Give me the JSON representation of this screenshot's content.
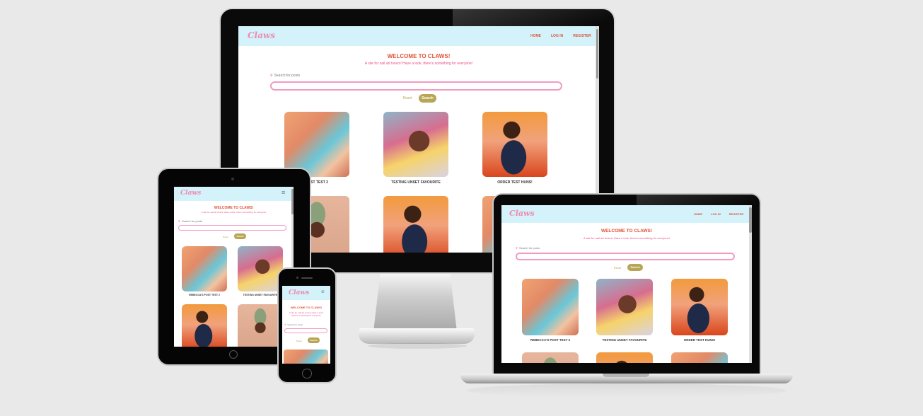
{
  "site": {
    "logo": "Claws",
    "nav": [
      "HOME",
      "LOG IN",
      "REGISTER"
    ],
    "title": "WELCOME TO CLAWS!",
    "tagline": "A site for nail art lovers! Have a look, there's something for everyone!",
    "search_label": "Search for posts",
    "reset_label": "Reset",
    "search_button": "Search",
    "hamburger": "≡",
    "posts": [
      {
        "title": "REBECCA'S POST TEST 2"
      },
      {
        "title": "TESTING UNSET FAVOURITE"
      },
      {
        "title": "ORDER TEST HUNS!"
      }
    ],
    "desktop_post1_partial": "POST TEST 2"
  },
  "colors": {
    "nav_bg": "#d3f2fa",
    "logo": "#f08ab0",
    "title": "#e0533a",
    "tagline": "#ec4a86",
    "button": "#b8a654",
    "input_border": "#f29bc2"
  }
}
